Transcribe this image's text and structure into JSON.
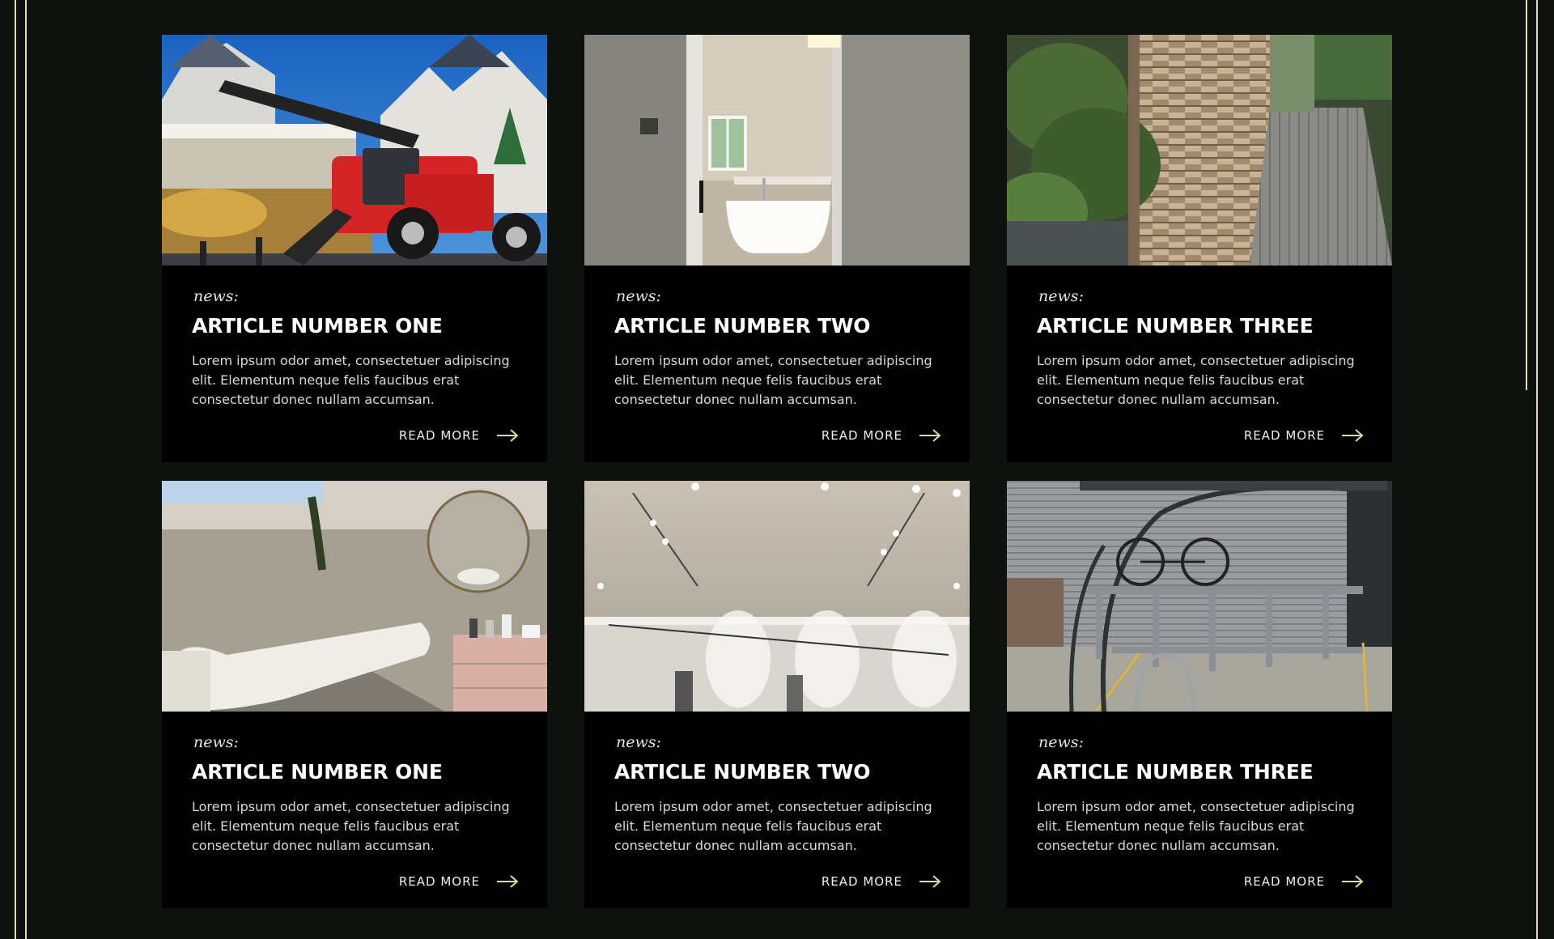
{
  "accent_color": "#e2d8a4",
  "articles": [
    {
      "kicker": "news:",
      "title": "ARTICLE NUMBER ONE",
      "excerpt": "Lorem ipsum odor amet, consectetuer adipiscing elit. Elementum neque felis faucibus erat consectetur donec nullam accumsan.",
      "cta": "READ MORE",
      "image": "construction-telehandler-photo"
    },
    {
      "kicker": "news:",
      "title": "ARTICLE NUMBER TWO",
      "excerpt": "Lorem ipsum odor amet, consectetuer adipiscing elit. Elementum neque felis faucibus erat consectetur donec nullam accumsan.",
      "cta": "READ MORE",
      "image": "bathroom-doorway-photo"
    },
    {
      "kicker": "news:",
      "title": "ARTICLE NUMBER THREE",
      "excerpt": "Lorem ipsum odor amet, consectetuer adipiscing elit. Elementum neque felis faucibus erat consectetur donec nullam accumsan.",
      "cta": "READ MORE",
      "image": "woven-fence-walkway-photo"
    },
    {
      "kicker": "news:",
      "title": "ARTICLE NUMBER ONE",
      "excerpt": "Lorem ipsum odor amet, consectetuer adipiscing elit. Elementum neque felis faucibus erat consectetur donec nullam accumsan.",
      "cta": "READ MORE",
      "image": "treatment-room-photo"
    },
    {
      "kicker": "news:",
      "title": "ARTICLE NUMBER TWO",
      "excerpt": "Lorem ipsum odor amet, consectetuer adipiscing elit. Elementum neque felis faucibus erat consectetur donec nullam accumsan.",
      "cta": "READ MORE",
      "image": "gallery-track-lighting-photo"
    },
    {
      "kicker": "news:",
      "title": "ARTICLE NUMBER THREE",
      "excerpt": "Lorem ipsum odor amet, consectetuer adipiscing elit. Elementum neque felis faucibus erat consectetur donec nullam accumsan.",
      "cta": "READ MORE",
      "image": "bike-rack-shelter-photo"
    }
  ]
}
